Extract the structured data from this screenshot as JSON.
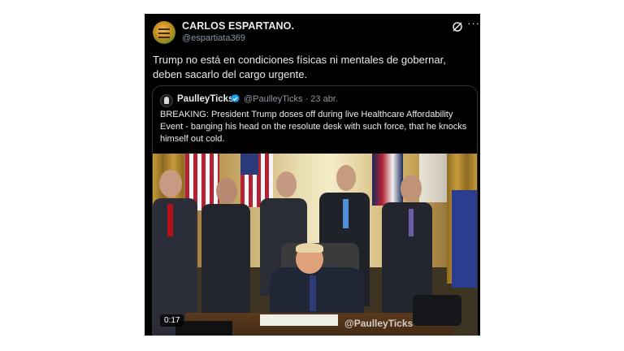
{
  "post": {
    "author_name": "CARLOS ESPARTANO.",
    "author_handle": "@espartiata369",
    "text": "Trump no está en condiciones físicas ni mentales de gobernar, deben sacarlo del cargo urgente.",
    "icons": [
      "grok-icon",
      "more-icon"
    ],
    "more_label": "···"
  },
  "quoted_post": {
    "author_name": "PaulleyTicks",
    "author_handle": "@PaulleyTicks",
    "date": "· 23 abr.",
    "verified": true,
    "text": "BREAKING: President Trump doses off during live Healthcare Affordability Event - banging his head on the resolute desk with such force, that he knocks himself out cold.",
    "media": {
      "duration": "0:17",
      "watermark": "@PaulleyTicks"
    }
  },
  "colors": {
    "background": "#000000",
    "text": "#e7e9ea",
    "secondary_text": "#8b98a5",
    "border": "#2f3336",
    "verified": "#1d9bf0"
  }
}
